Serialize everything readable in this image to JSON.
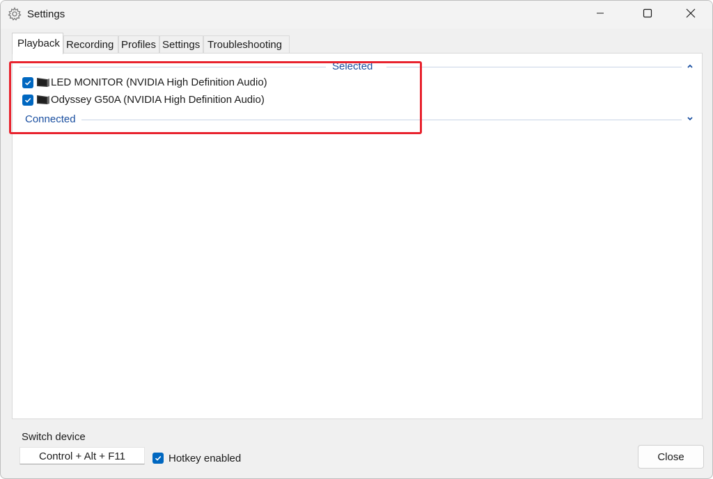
{
  "window": {
    "title": "Settings",
    "title_icon": "gear-icon",
    "controls": [
      "minimize-icon",
      "maximize-icon",
      "close-icon"
    ]
  },
  "tabs": [
    {
      "label": "Playback",
      "active": true
    },
    {
      "label": "Recording",
      "active": false
    },
    {
      "label": "Profiles",
      "active": false
    },
    {
      "label": "Settings",
      "active": false
    },
    {
      "label": "Troubleshooting",
      "active": false
    }
  ],
  "playback": {
    "groups": {
      "selected_label": "Selected",
      "connected_label": "Connected"
    },
    "devices": [
      {
        "name": "LED MONITOR (NVIDIA High Definition Audio)",
        "checked": true,
        "icon": "monitor-icon"
      },
      {
        "name": "Odyssey G50A (NVIDIA High Definition Audio)",
        "checked": true,
        "icon": "monitor-icon"
      }
    ]
  },
  "footer": {
    "switch_device_label": "Switch device",
    "hotkey": "Control + Alt + F11",
    "hotkey_enabled_label": "Hotkey enabled",
    "hotkey_enabled": true,
    "close_label": "Close"
  },
  "colors": {
    "accent": "#0067c0",
    "group_text": "#1a4fa0",
    "highlight": "#e8232e"
  }
}
